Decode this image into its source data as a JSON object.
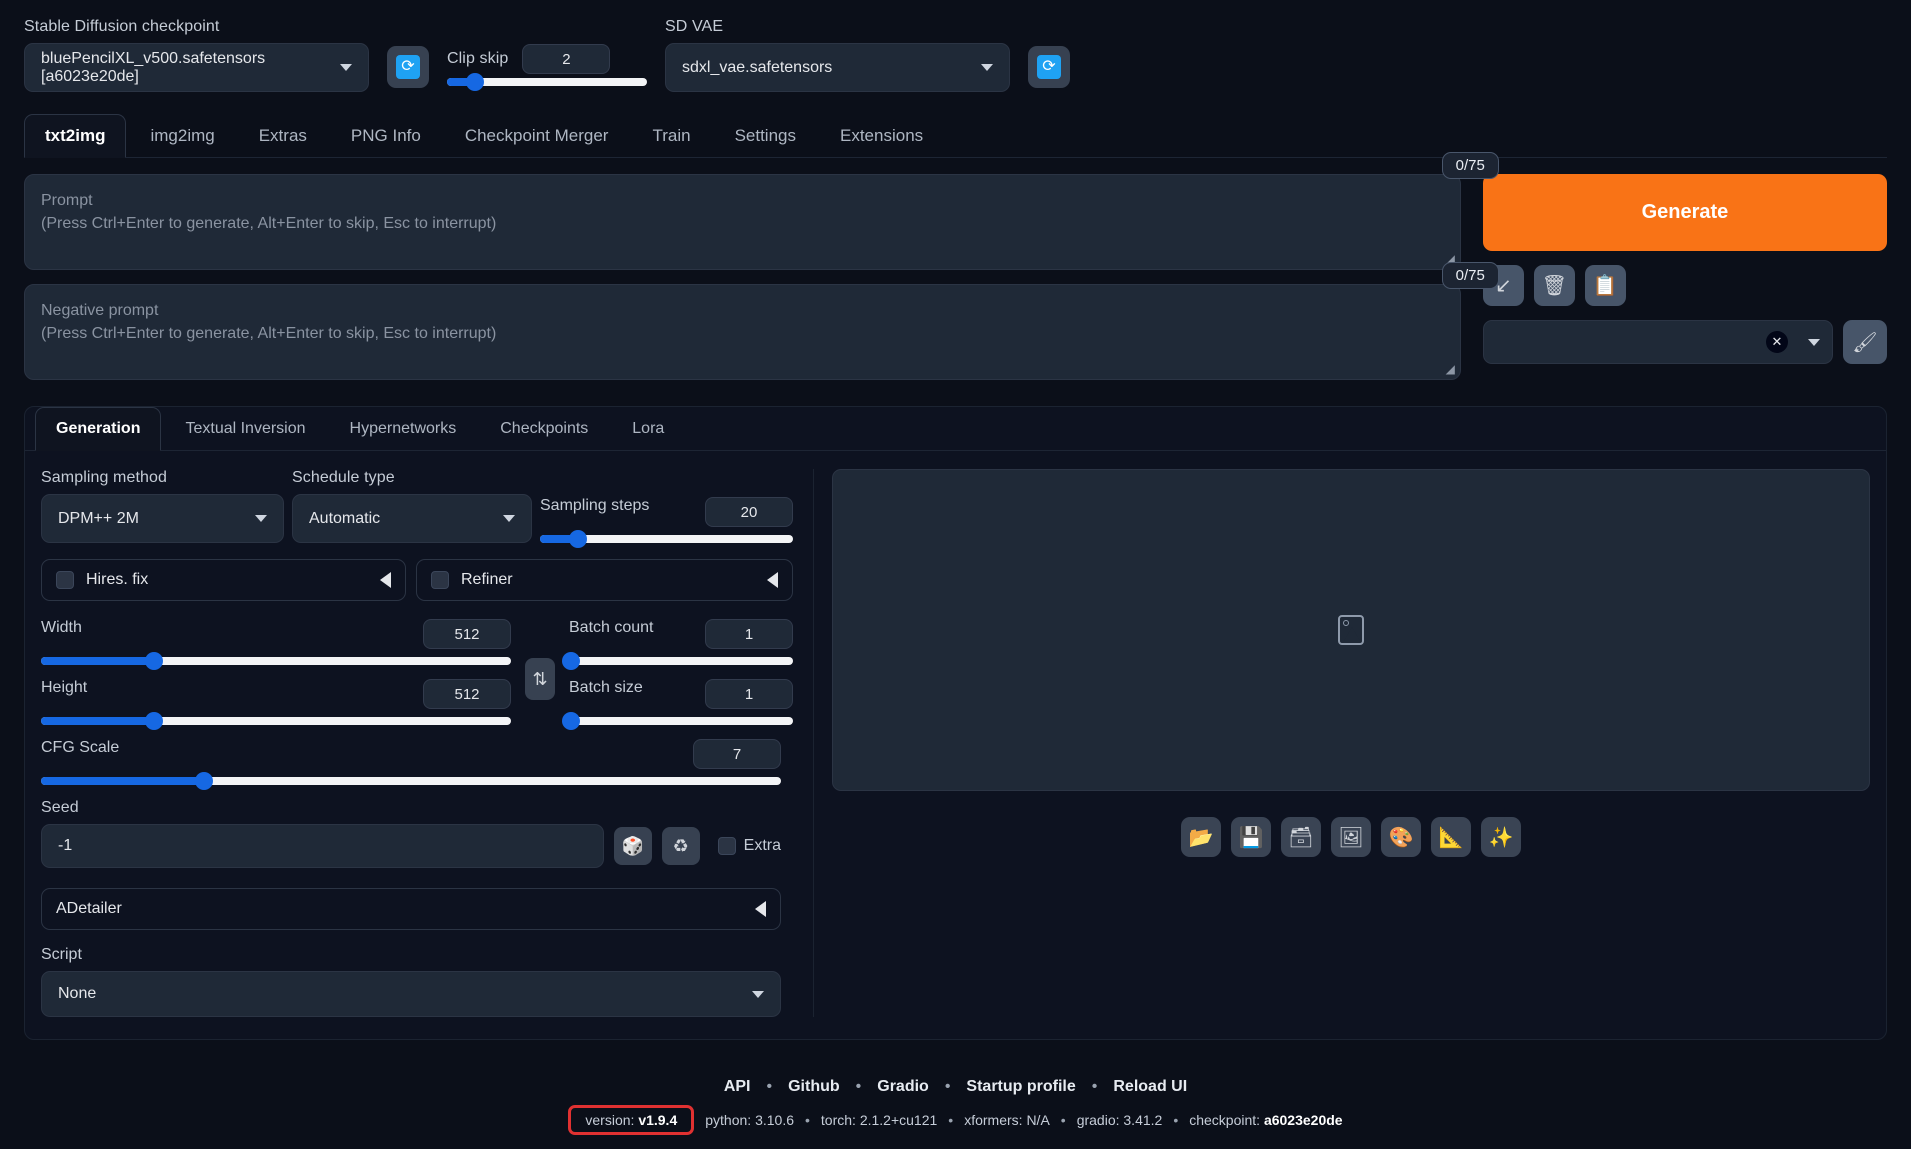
{
  "topbar": {
    "checkpoint_label": "Stable Diffusion checkpoint",
    "checkpoint_value": "bluePencilXL_v500.safetensors [a6023e20de]",
    "refresh_icon": "refresh-icon",
    "clip_skip_label": "Clip skip",
    "clip_skip_value": "2",
    "clip_skip_percent": 14,
    "vae_label": "SD VAE",
    "vae_value": "sdxl_vae.safetensors",
    "vae_refresh_icon": "refresh-icon"
  },
  "main_tabs": [
    {
      "label": "txt2img",
      "active": true
    },
    {
      "label": "img2img",
      "active": false
    },
    {
      "label": "Extras",
      "active": false
    },
    {
      "label": "PNG Info",
      "active": false
    },
    {
      "label": "Checkpoint Merger",
      "active": false
    },
    {
      "label": "Train",
      "active": false
    },
    {
      "label": "Settings",
      "active": false
    },
    {
      "label": "Extensions",
      "active": false
    }
  ],
  "prompt": {
    "value": "",
    "placeholder_line1": "Prompt",
    "placeholder_line2": "(Press Ctrl+Enter to generate, Alt+Enter to skip, Esc to interrupt)",
    "counter": "0/75"
  },
  "negative_prompt": {
    "value": "",
    "placeholder_line1": "Negative prompt",
    "placeholder_line2": "(Press Ctrl+Enter to generate, Alt+Enter to skip, Esc to interrupt)",
    "counter": "0/75"
  },
  "generate": {
    "label": "Generate",
    "color": "#f97316",
    "tools": [
      {
        "icon": "arrow-down-left-icon",
        "glyph": "↙"
      },
      {
        "icon": "trash-icon",
        "glyph": "🗑"
      },
      {
        "icon": "clipboard-icon",
        "glyph": "📋"
      }
    ],
    "styles_value": "",
    "styles_clear_icon": "close-icon",
    "styles_caret_icon": "chevron-down-icon",
    "brush_icon": "paintbrush-icon"
  },
  "sub_tabs": [
    {
      "label": "Generation",
      "active": true
    },
    {
      "label": "Textual Inversion",
      "active": false
    },
    {
      "label": "Hypernetworks",
      "active": false
    },
    {
      "label": "Checkpoints",
      "active": false
    },
    {
      "label": "Lora",
      "active": false
    }
  ],
  "generation": {
    "sampling_method_label": "Sampling method",
    "sampling_method_value": "DPM++ 2M",
    "schedule_type_label": "Schedule type",
    "schedule_type_value": "Automatic",
    "sampling_steps_label": "Sampling steps",
    "sampling_steps_value": "20",
    "sampling_steps_percent": 15,
    "hires_fix_label": "Hires. fix",
    "refiner_label": "Refiner",
    "width_label": "Width",
    "width_value": "512",
    "width_percent": 24,
    "height_label": "Height",
    "height_value": "512",
    "height_percent": 24,
    "cfg_label": "CFG Scale",
    "cfg_value": "7",
    "cfg_percent": 22,
    "batch_count_label": "Batch count",
    "batch_count_value": "1",
    "batch_count_percent": 1,
    "batch_size_label": "Batch size",
    "batch_size_value": "1",
    "batch_size_percent": 1,
    "swap_icon": "swap-dimensions-icon",
    "seed_label": "Seed",
    "seed_value": "-1",
    "dice_icon": "dice-icon",
    "recycle_icon": "recycle-icon",
    "extra_label": "Extra",
    "adetailer_label": "ADetailer",
    "script_label": "Script",
    "script_value": "None"
  },
  "output": {
    "placeholder_icon": "image-placeholder-icon",
    "tools": [
      {
        "icon": "folder-icon",
        "glyph": "📂"
      },
      {
        "icon": "save-icon",
        "glyph": "💾"
      },
      {
        "icon": "zip-icon",
        "glyph": "🗃"
      },
      {
        "icon": "send-to-img2img-icon",
        "glyph": "🖼"
      },
      {
        "icon": "send-to-inpaint-icon",
        "glyph": "🎨"
      },
      {
        "icon": "send-to-extras-icon",
        "glyph": "📐"
      },
      {
        "icon": "sparkles-icon",
        "glyph": "✨"
      }
    ]
  },
  "footer": {
    "links": [
      "API",
      "Github",
      "Gradio",
      "Startup profile",
      "Reload UI"
    ],
    "separator": "•",
    "version_prefix": "version:",
    "version_value": "v1.9.4",
    "python_prefix": "python:",
    "python_value": "3.10.6",
    "torch_prefix": "torch:",
    "torch_value": "2.1.2+cu121",
    "xformers_prefix": "xformers:",
    "xformers_value": "N/A",
    "gradio_prefix": "gradio:",
    "gradio_value": "3.41.2",
    "checkpoint_prefix": "checkpoint:",
    "checkpoint_value": "a6023e20de",
    "highlight_color": "#e03131"
  }
}
